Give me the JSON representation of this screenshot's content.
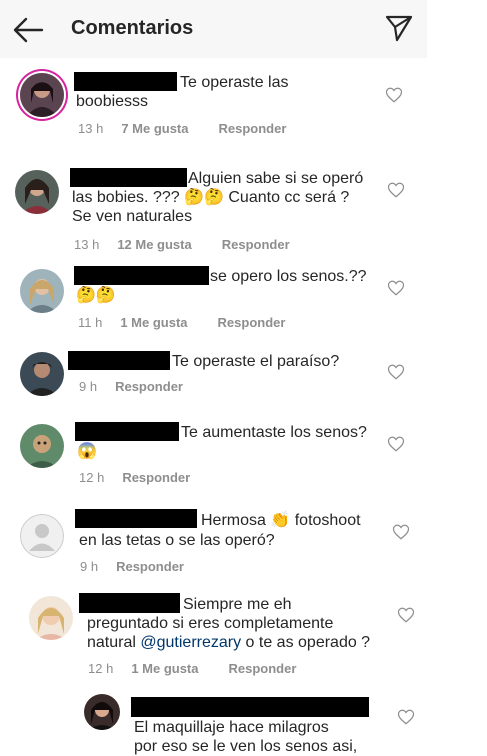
{
  "header": {
    "title": "Comentarios"
  },
  "comments": [
    {
      "text": "Te operaste las\nboobiesss",
      "time": "13 h",
      "likes": "7 Me gusta",
      "reply": "Responder"
    },
    {
      "text": "Alguien sabe si se operó\nlas bobies. ??? 🤔🤔 Cuanto cc será ?\nSe ven naturales",
      "time": "13 h",
      "likes": "12 Me gusta",
      "reply": "Responder"
    },
    {
      "text": "se opero los senos.??\n🤔🤔",
      "time": "11 h",
      "likes": "1 Me gusta",
      "reply": "Responder"
    },
    {
      "text": "Te operaste el paraíso?",
      "time": "9 h",
      "reply": "Responder"
    },
    {
      "text": "Te aumentaste los senos?\n😱",
      "time": "12 h",
      "reply": "Responder"
    },
    {
      "text_a": "Hermosa 👏 fotoshoot",
      "text_b": "en las tetas o se las operó?",
      "time": "9 h",
      "reply": "Responder"
    },
    {
      "text_a": "Siempre me eh\npreguntado si eres completamente\nnatural ",
      "mention": "@gutierrezary",
      "text_b": "  o te as operado ?",
      "time": "12 h",
      "likes": "1 Me gusta",
      "reply": "Responder"
    },
    {
      "text": "El maquillaje hace milagros\npor eso se le ven los senos asi,"
    }
  ],
  "colors": {
    "ring": "#d6249f",
    "mention": "#00376b",
    "meta": "#8e8e8e"
  }
}
